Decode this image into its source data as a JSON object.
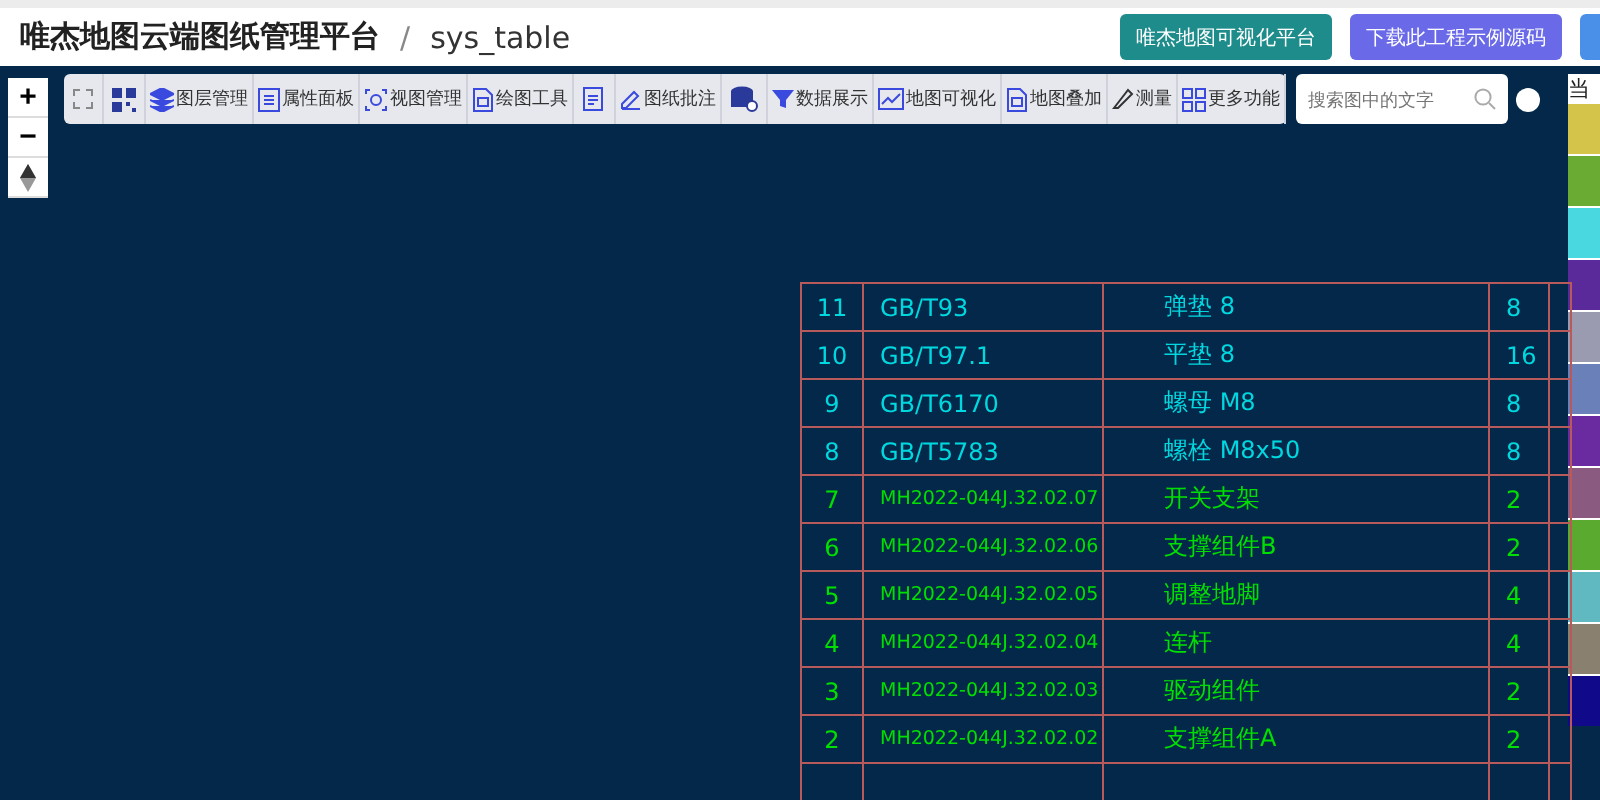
{
  "header": {
    "title": "唯杰地图云端图纸管理平台",
    "separator": "/",
    "subtitle": "sys_table",
    "buttons": [
      {
        "label": "唯杰地图可视化平台",
        "kind": "teal"
      },
      {
        "label": "下载此工程示例源码",
        "kind": "purple"
      }
    ]
  },
  "zoom_controls": [
    "+",
    "−"
  ],
  "toolbar": [
    {
      "kind": "icon_only"
    },
    {
      "kind": "icon_only"
    },
    {
      "kind": "labeled",
      "label": "图层管理"
    },
    {
      "kind": "labeled",
      "label": "属性面板"
    },
    {
      "kind": "labeled",
      "label": "视图管理"
    },
    {
      "kind": "labeled",
      "label": "绘图工具"
    },
    {
      "kind": "icon_only"
    },
    {
      "kind": "labeled",
      "label": "图纸批注"
    },
    {
      "kind": "icon_only"
    },
    {
      "kind": "labeled",
      "label": "数据展示"
    },
    {
      "kind": "labeled",
      "label": "地图可视化"
    },
    {
      "kind": "labeled",
      "label": "地图叠加"
    },
    {
      "kind": "labeled",
      "label": "测量"
    },
    {
      "kind": "labeled",
      "label": "更多功能"
    }
  ],
  "search": {
    "placeholder": "搜索图中的文字"
  },
  "side_panel": {
    "title": "当",
    "swatches": [
      {
        "color": "#d4c44a"
      },
      {
        "color": "#6aab34"
      },
      {
        "color": "#4ad8e0"
      },
      {
        "color": "#5a2a9a"
      },
      {
        "color": "#9a9ab0"
      },
      {
        "color": "#6a80b8"
      },
      {
        "color": "#6a2aa0"
      },
      {
        "color": "#8a5a80"
      },
      {
        "color": "#5aaa30"
      },
      {
        "color": "#60b8c0"
      },
      {
        "color": "#8a8070"
      },
      {
        "color": "#100a8a"
      }
    ]
  },
  "table": {
    "rows": [
      {
        "no": "11",
        "code": "GB/T93",
        "name": "弹垫 8",
        "qty": "8",
        "color": "#00d8e0"
      },
      {
        "no": "10",
        "code": "GB/T97.1",
        "name": "平垫 8",
        "qty": "16",
        "color": "#00d8e0"
      },
      {
        "no": "9",
        "code": "GB/T6170",
        "name": "螺母 M8",
        "qty": "8",
        "color": "#00d8e0"
      },
      {
        "no": "8",
        "code": "GB/T5783",
        "name": "螺栓 M8x50",
        "qty": "8",
        "color": "#00d8e0"
      },
      {
        "no": "7",
        "code": "MH2022-044J.32.02.07",
        "name": "开关支架",
        "qty": "2",
        "color": "#00e000"
      },
      {
        "no": "6",
        "code": "MH2022-044J.32.02.06",
        "name": "支撑组件B",
        "qty": "2",
        "color": "#00e000"
      },
      {
        "no": "5",
        "code": "MH2022-044J.32.02.05",
        "name": "调整地脚",
        "qty": "4",
        "color": "#00e000"
      },
      {
        "no": "4",
        "code": "MH2022-044J.32.02.04",
        "name": "连杆",
        "qty": "4",
        "color": "#00e000"
      },
      {
        "no": "3",
        "code": "MH2022-044J.32.02.03",
        "name": "驱动组件",
        "qty": "2",
        "color": "#00e000"
      },
      {
        "no": "2",
        "code": "MH2022-044J.32.02.02",
        "name": "支撑组件A",
        "qty": "2",
        "color": "#00e000"
      }
    ]
  }
}
